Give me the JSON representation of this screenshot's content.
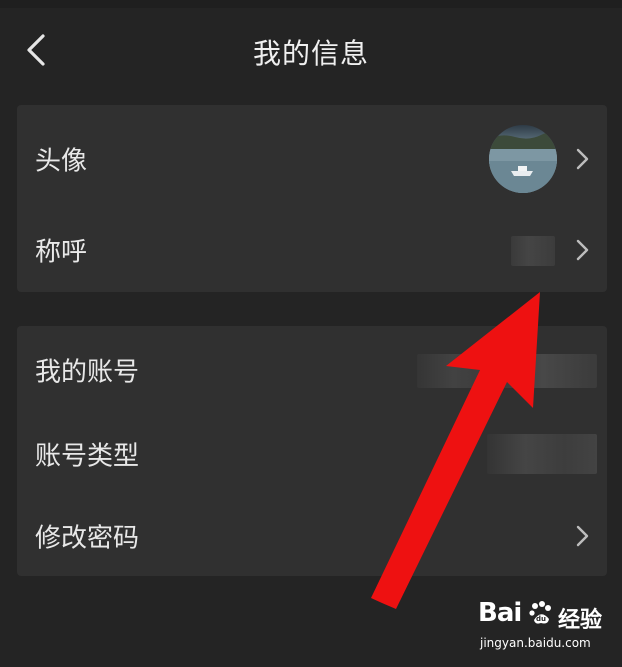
{
  "header": {
    "title": "我的信息",
    "back_icon": "chevron-left-icon"
  },
  "profile_section": {
    "rows": [
      {
        "label": "头像",
        "value_type": "avatar-image",
        "has_chevron": true
      },
      {
        "label": "称呼",
        "value_type": "blurred-text",
        "has_chevron": true
      }
    ]
  },
  "account_section": {
    "rows": [
      {
        "label": "我的账号",
        "value_type": "blurred-text",
        "has_chevron": false
      },
      {
        "label": "账号类型",
        "value_type": "blurred-text",
        "has_chevron": false
      },
      {
        "label": "修改密码",
        "value_type": "none",
        "has_chevron": true
      }
    ]
  },
  "annotation": {
    "type": "red-arrow",
    "color": "#ee1111"
  },
  "watermark": {
    "brand": "Bai",
    "brand_suffix": "du",
    "cn_label": "经验",
    "url": "jingyan.baidu.com"
  },
  "colors": {
    "background": "#242424",
    "card": "#303030",
    "text": "#e8e8e8",
    "chevron": "#bdbdbd"
  }
}
